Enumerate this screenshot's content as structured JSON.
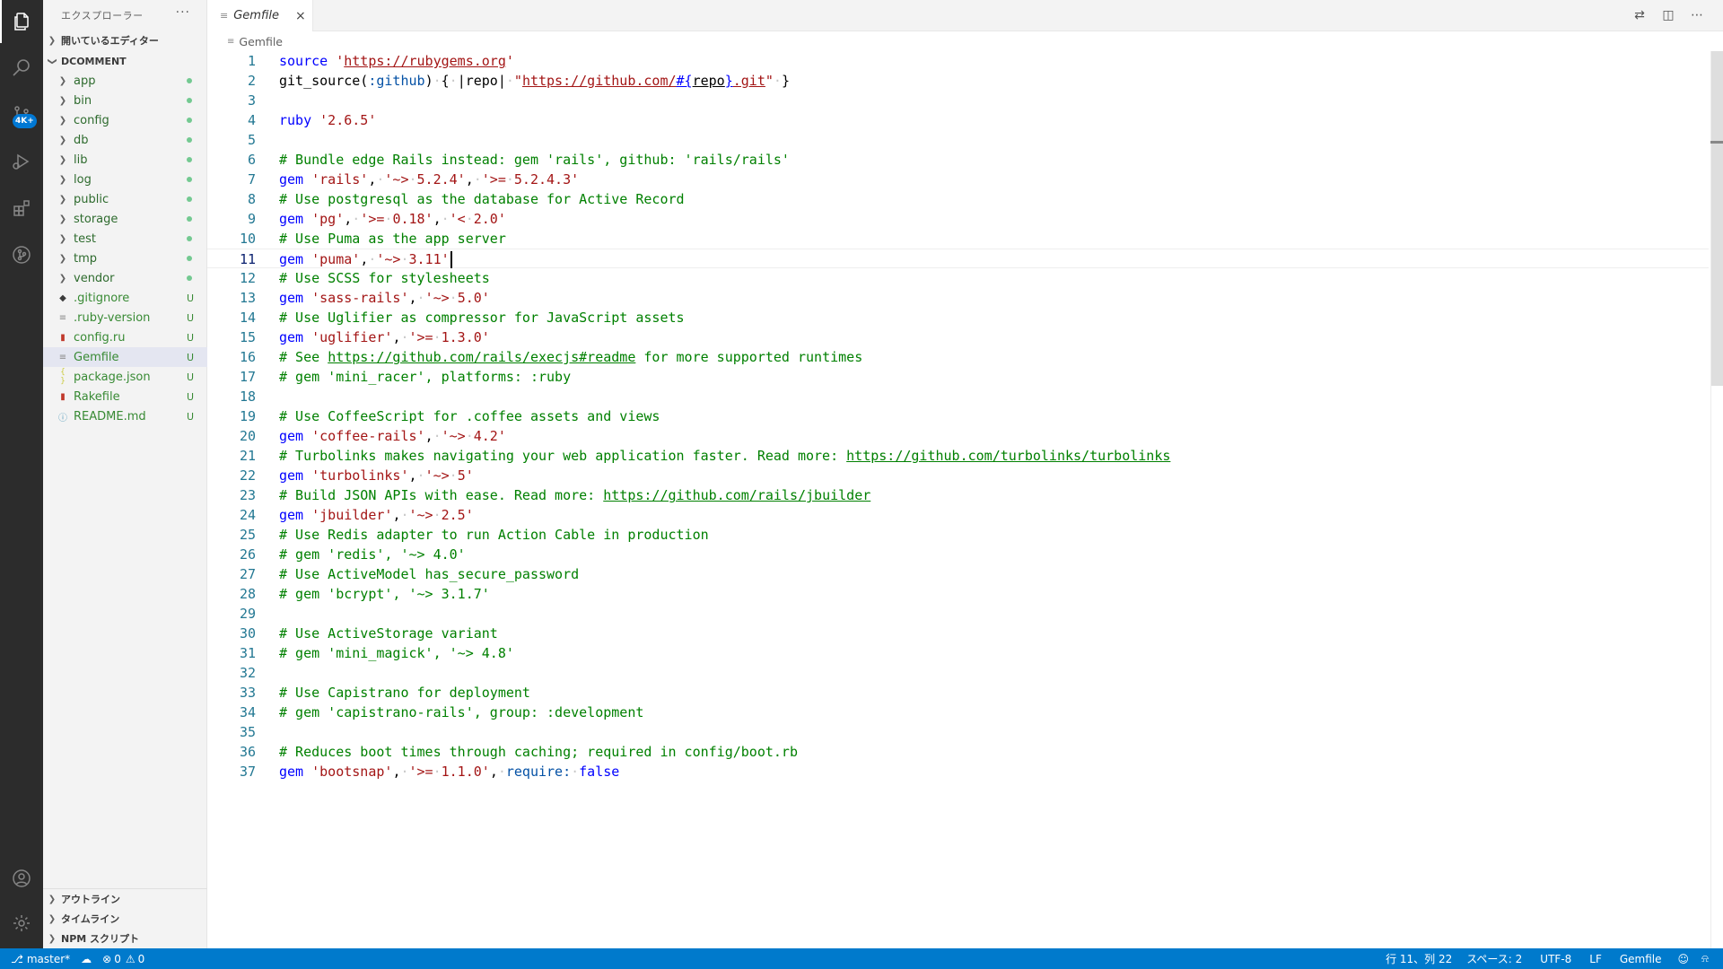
{
  "sidebar": {
    "title": "エクスプローラー",
    "more": "···",
    "open_editors": "開いているエディター",
    "workspace": "DCOMMENT",
    "items": [
      {
        "name": "app",
        "kind": "folder",
        "status": "dot"
      },
      {
        "name": "bin",
        "kind": "folder",
        "status": "dot"
      },
      {
        "name": "config",
        "kind": "folder",
        "status": "dot"
      },
      {
        "name": "db",
        "kind": "folder",
        "status": "dot"
      },
      {
        "name": "lib",
        "kind": "folder",
        "status": "dot"
      },
      {
        "name": "log",
        "kind": "folder",
        "status": "dot"
      },
      {
        "name": "public",
        "kind": "folder",
        "status": "dot"
      },
      {
        "name": "storage",
        "kind": "folder",
        "status": "dot"
      },
      {
        "name": "test",
        "kind": "folder",
        "status": "dot"
      },
      {
        "name": "tmp",
        "kind": "folder",
        "status": "dot"
      },
      {
        "name": "vendor",
        "kind": "folder",
        "status": "dot"
      },
      {
        "name": ".gitignore",
        "kind": "file",
        "icon": "git-icon",
        "status": "U"
      },
      {
        "name": ".ruby-version",
        "kind": "file",
        "icon": "text-file-icon",
        "status": "U"
      },
      {
        "name": "config.ru",
        "kind": "file",
        "icon": "ruby-icon",
        "status": "U"
      },
      {
        "name": "Gemfile",
        "kind": "file",
        "icon": "text-file-icon",
        "status": "U",
        "selected": true
      },
      {
        "name": "package.json",
        "kind": "file",
        "icon": "json-icon",
        "status": "U"
      },
      {
        "name": "Rakefile",
        "kind": "file",
        "icon": "ruby-icon",
        "status": "U"
      },
      {
        "name": "README.md",
        "kind": "file",
        "icon": "info-icon",
        "status": "U"
      }
    ],
    "outline": "アウトライン",
    "timeline": "タイムライン",
    "npm": "NPM スクリプト"
  },
  "activity": {
    "badge": "4K+"
  },
  "tab": {
    "label": "Gemfile",
    "close": "×"
  },
  "breadcrumb": {
    "label": "Gemfile"
  },
  "code": {
    "current_line": 11,
    "lines": [
      [
        [
          "kw",
          "source"
        ],
        [
          "pl",
          " "
        ],
        [
          "str",
          "'"
        ],
        [
          "str ul",
          "https://rubygems.org"
        ],
        [
          "str",
          "'"
        ]
      ],
      [
        [
          "pl",
          "git_source("
        ],
        [
          "sym",
          ":github"
        ],
        [
          "pl",
          ")"
        ],
        [
          "ws",
          "·"
        ],
        [
          "pl",
          "{"
        ],
        [
          "ws",
          "·"
        ],
        [
          "pl",
          "|repo|"
        ],
        [
          "ws",
          "·"
        ],
        [
          "str",
          "\""
        ],
        [
          "str ul",
          "https://github.com/"
        ],
        [
          "kw ul",
          "#{"
        ],
        [
          "pl ul",
          "repo"
        ],
        [
          "kw ul",
          "}"
        ],
        [
          "str ul",
          ".git"
        ],
        [
          "str",
          "\""
        ],
        [
          "ws",
          "·"
        ],
        [
          "pl",
          "}"
        ]
      ],
      [],
      [
        [
          "kw",
          "ruby"
        ],
        [
          "pl",
          " "
        ],
        [
          "str",
          "'2.6.5'"
        ]
      ],
      [],
      [
        [
          "cm",
          "# Bundle edge Rails instead: gem 'rails', github: 'rails/rails'"
        ]
      ],
      [
        [
          "kw",
          "gem"
        ],
        [
          "pl",
          " "
        ],
        [
          "str",
          "'rails'"
        ],
        [
          "pl",
          ","
        ],
        [
          "ws",
          "·"
        ],
        [
          "str",
          "'~>"
        ],
        [
          "ws",
          "·"
        ],
        [
          "str",
          "5.2.4'"
        ],
        [
          "pl",
          ","
        ],
        [
          "ws",
          "·"
        ],
        [
          "str",
          "'>="
        ],
        [
          "ws",
          "·"
        ],
        [
          "str",
          "5.2.4.3'"
        ]
      ],
      [
        [
          "cm",
          "# Use postgresql as the database for Active Record"
        ]
      ],
      [
        [
          "kw",
          "gem"
        ],
        [
          "pl",
          " "
        ],
        [
          "str",
          "'pg'"
        ],
        [
          "pl",
          ","
        ],
        [
          "ws",
          "·"
        ],
        [
          "str",
          "'>="
        ],
        [
          "ws",
          "·"
        ],
        [
          "str",
          "0.18'"
        ],
        [
          "pl",
          ","
        ],
        [
          "ws",
          "·"
        ],
        [
          "str",
          "'<"
        ],
        [
          "ws",
          "·"
        ],
        [
          "str",
          "2.0'"
        ]
      ],
      [
        [
          "cm",
          "# Use Puma as the app server"
        ]
      ],
      [
        [
          "kw",
          "gem"
        ],
        [
          "pl",
          " "
        ],
        [
          "str",
          "'puma'"
        ],
        [
          "pl",
          ","
        ],
        [
          "ws",
          "·"
        ],
        [
          "str",
          "'~>"
        ],
        [
          "ws",
          "·"
        ],
        [
          "str",
          "3.11'"
        ]
      ],
      [
        [
          "cm",
          "# Use SCSS for stylesheets"
        ]
      ],
      [
        [
          "kw",
          "gem"
        ],
        [
          "pl",
          " "
        ],
        [
          "str",
          "'sass-rails'"
        ],
        [
          "pl",
          ","
        ],
        [
          "ws",
          "·"
        ],
        [
          "str",
          "'~>"
        ],
        [
          "ws",
          "·"
        ],
        [
          "str",
          "5.0'"
        ]
      ],
      [
        [
          "cm",
          "# Use Uglifier as compressor for JavaScript assets"
        ]
      ],
      [
        [
          "kw",
          "gem"
        ],
        [
          "pl",
          " "
        ],
        [
          "str",
          "'uglifier'"
        ],
        [
          "pl",
          ","
        ],
        [
          "ws",
          "·"
        ],
        [
          "str",
          "'>="
        ],
        [
          "ws",
          "·"
        ],
        [
          "str",
          "1.3.0'"
        ]
      ],
      [
        [
          "cm",
          "# See "
        ],
        [
          "cm ul",
          "https://github.com/rails/execjs#readme"
        ],
        [
          "cm",
          " for more supported runtimes"
        ]
      ],
      [
        [
          "cm",
          "# gem 'mini_racer', platforms: :ruby"
        ]
      ],
      [],
      [
        [
          "cm",
          "# Use CoffeeScript for .coffee assets and views"
        ]
      ],
      [
        [
          "kw",
          "gem"
        ],
        [
          "pl",
          " "
        ],
        [
          "str",
          "'coffee-rails'"
        ],
        [
          "pl",
          ","
        ],
        [
          "ws",
          "·"
        ],
        [
          "str",
          "'~>"
        ],
        [
          "ws",
          "·"
        ],
        [
          "str",
          "4.2'"
        ]
      ],
      [
        [
          "cm",
          "# Turbolinks makes navigating your web application faster. Read more: "
        ],
        [
          "cm ul",
          "https://github.com/turbolinks/turbolinks"
        ]
      ],
      [
        [
          "kw",
          "gem"
        ],
        [
          "pl",
          " "
        ],
        [
          "str",
          "'turbolinks'"
        ],
        [
          "pl",
          ","
        ],
        [
          "ws",
          "·"
        ],
        [
          "str",
          "'~>"
        ],
        [
          "ws",
          "·"
        ],
        [
          "str",
          "5'"
        ]
      ],
      [
        [
          "cm",
          "# Build JSON APIs with ease. Read more: "
        ],
        [
          "cm ul",
          "https://github.com/rails/jbuilder"
        ]
      ],
      [
        [
          "kw",
          "gem"
        ],
        [
          "pl",
          " "
        ],
        [
          "str",
          "'jbuilder'"
        ],
        [
          "pl",
          ","
        ],
        [
          "ws",
          "·"
        ],
        [
          "str",
          "'~>"
        ],
        [
          "ws",
          "·"
        ],
        [
          "str",
          "2.5'"
        ]
      ],
      [
        [
          "cm",
          "# Use Redis adapter to run Action Cable in production"
        ]
      ],
      [
        [
          "cm",
          "# gem 'redis', '~> 4.0'"
        ]
      ],
      [
        [
          "cm",
          "# Use ActiveModel has_secure_password"
        ]
      ],
      [
        [
          "cm",
          "# gem 'bcrypt', '~> 3.1.7'"
        ]
      ],
      [],
      [
        [
          "cm",
          "# Use ActiveStorage variant"
        ]
      ],
      [
        [
          "cm",
          "# gem 'mini_magick', '~> 4.8'"
        ]
      ],
      [],
      [
        [
          "cm",
          "# Use Capistrano for deployment"
        ]
      ],
      [
        [
          "cm",
          "# gem 'capistrano-rails', group: :development"
        ]
      ],
      [],
      [
        [
          "cm",
          "# Reduces boot times through caching; required in config/boot.rb"
        ]
      ],
      [
        [
          "kw",
          "gem"
        ],
        [
          "pl",
          " "
        ],
        [
          "str",
          "'bootsnap'"
        ],
        [
          "pl",
          ","
        ],
        [
          "ws",
          "·"
        ],
        [
          "str",
          "'>="
        ],
        [
          "ws",
          "·"
        ],
        [
          "str",
          "1.1.0'"
        ],
        [
          "pl",
          ","
        ],
        [
          "ws",
          "·"
        ],
        [
          "sym",
          "require:"
        ],
        [
          "ws",
          "·"
        ],
        [
          "kw",
          "false"
        ]
      ]
    ]
  },
  "status": {
    "branch": "master*",
    "errors": "0",
    "warnings": "0",
    "position": "行 11、列 22",
    "spaces": "スペース: 2",
    "encoding": "UTF-8",
    "eol": "LF",
    "language": "Gemfile"
  }
}
